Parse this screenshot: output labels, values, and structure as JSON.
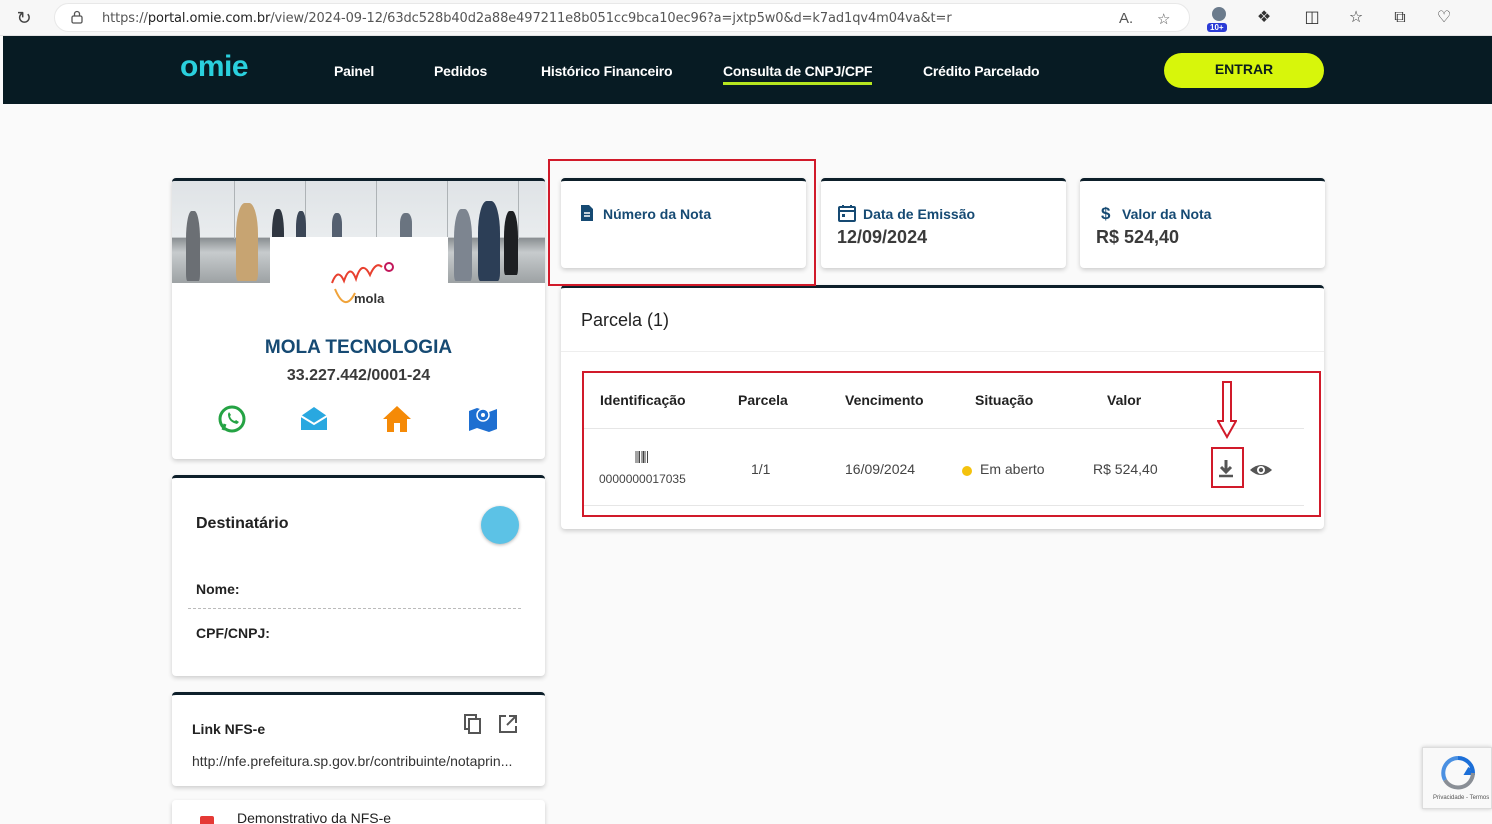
{
  "browser": {
    "url_prefix": "https://",
    "url_host": "portal.omie.com.br",
    "url_rest": "/view/2024-09-12/63dc528b40d2a88e497211e8b051cc9bca10ec96?a=jxtp5w0&d=k7ad1qv4m04va&t=r",
    "ext_badge": "10+"
  },
  "header": {
    "logo": "omie",
    "nav": [
      "Painel",
      "Pedidos",
      "Histórico Financeiro",
      "Consulta de CNPJ/CPF",
      "Crédito Parcelado"
    ],
    "active_nav": "Consulta de CNPJ/CPF",
    "login_label": "ENTRAR"
  },
  "company": {
    "logo_text": "mola",
    "name": "MOLA TECNOLOGIA",
    "cnpj": "33.227.442/0001-24",
    "social_icons": [
      "whatsapp-icon",
      "email-icon",
      "home-icon",
      "map-icon"
    ]
  },
  "recipient": {
    "title": "Destinatário",
    "name_label": "Nome:",
    "doc_label": "CPF/CNPJ:"
  },
  "nfse_link": {
    "title": "Link NFS-e",
    "url": "http://nfe.prefeitura.sp.gov.br/contribuinte/notaprin..."
  },
  "demo": {
    "title": "Demonstrativo da NFS-e"
  },
  "invoice": {
    "number_label": "Número da Nota",
    "number_value": "",
    "date_label": "Data de Emissão",
    "date_value": "12/09/2024",
    "amount_label": "Valor da Nota",
    "amount_value": "R$ 524,40"
  },
  "installments": {
    "title": "Parcela (1)",
    "columns": [
      "Identificação",
      "Parcela",
      "Vencimento",
      "Situação",
      "Valor"
    ],
    "rows": [
      {
        "id": "0000000017035",
        "parcela": "1/1",
        "vencimento": "16/09/2024",
        "situacao": "Em aberto",
        "valor": "R$ 524,40"
      }
    ]
  },
  "recaptcha": {
    "text": "Privacidade - Termos"
  },
  "colors": {
    "header_bg": "#071b23",
    "accent_lime": "#d7f60b",
    "brand_teal": "#2ad0dd",
    "title_blue": "#164a73",
    "annotation_red": "#d11a2a",
    "status_yellow": "#f4c20d"
  }
}
